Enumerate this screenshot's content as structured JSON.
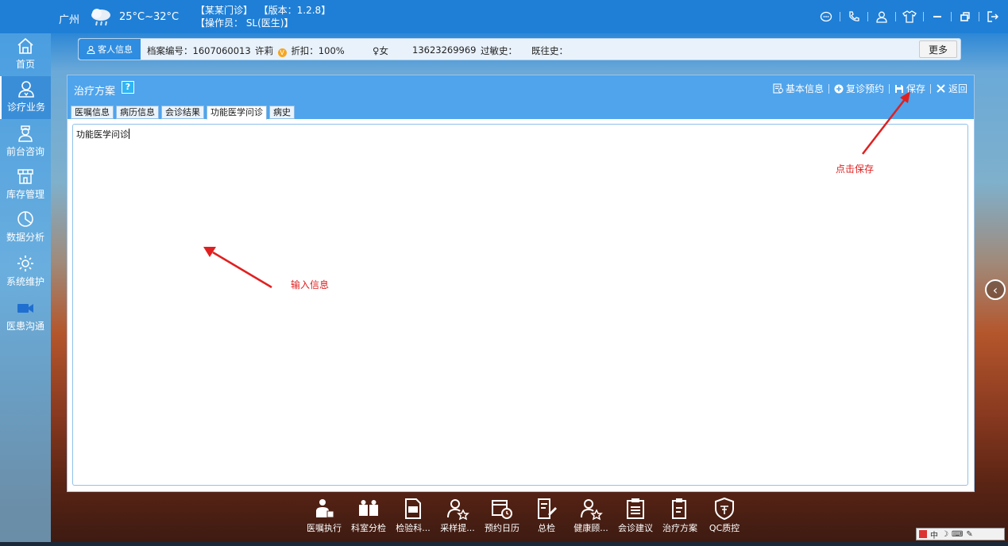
{
  "topbar": {
    "city": "广州",
    "temperature": "25°C~32°C",
    "clinic": "【某某门诊】",
    "version": "【版本：1.2.8】",
    "operator": "【操作员： SL(医生)】",
    "icons": [
      "chat-icon",
      "phone-icon",
      "user-icon",
      "skin-icon",
      "minimize-icon",
      "restore-icon",
      "exit-icon"
    ]
  },
  "sidebar": {
    "items": [
      {
        "label": "首页",
        "icon": "home-icon"
      },
      {
        "label": "诊疗业务",
        "icon": "doctor-icon"
      },
      {
        "label": "前台咨询",
        "icon": "nurse-icon"
      },
      {
        "label": "库存管理",
        "icon": "store-icon"
      },
      {
        "label": "数据分析",
        "icon": "pie-chart-icon"
      },
      {
        "label": "系统维护",
        "icon": "gear-icon"
      },
      {
        "label": "医患沟通",
        "icon": "video-icon"
      }
    ]
  },
  "patient": {
    "tag_label": "客人信息",
    "file_no": "档案编号：1607060013",
    "name": "许莉",
    "vip": "V",
    "discount": "折扣：100%",
    "gender": "女",
    "phone": "13623269969",
    "allergy": "过敏史：",
    "history": "既往史：",
    "more_label": "更多"
  },
  "panel": {
    "title": "治疗方案",
    "help": "?",
    "actions": {
      "basic_info": "基本信息",
      "revisit": "复诊预约",
      "save": "保存",
      "back": "返回"
    },
    "tabs": [
      {
        "label": "医嘱信息",
        "active": false
      },
      {
        "label": "病历信息",
        "active": false
      },
      {
        "label": "会诊结果",
        "active": false
      },
      {
        "label": "功能医学问诊",
        "active": true
      },
      {
        "label": "病史",
        "active": false
      }
    ],
    "editor_text": "功能医学问诊"
  },
  "annotations": {
    "click_save": "点击保存",
    "input_info": "输入信息",
    "color": "#e02020"
  },
  "bottombar": {
    "items": [
      {
        "label": "医嘱执行",
        "icon": "prescription-icon"
      },
      {
        "label": "科室分检",
        "icon": "department-icon"
      },
      {
        "label": "检验科...",
        "icon": "exe-icon"
      },
      {
        "label": "采样提...",
        "icon": "sample-icon"
      },
      {
        "label": "预约日历",
        "icon": "calendar-icon"
      },
      {
        "label": "总检",
        "icon": "edit-icon"
      },
      {
        "label": "健康顾...",
        "icon": "advisor-icon"
      },
      {
        "label": "会诊建议",
        "icon": "clipboard-icon"
      },
      {
        "label": "治疗方案",
        "icon": "document-icon"
      },
      {
        "label": "QC质控",
        "icon": "quality-shield-icon"
      }
    ]
  },
  "ime": {
    "text": "中"
  },
  "colors": {
    "brand": "#1f7fd6",
    "panel_head": "#4fa4ec",
    "accent_red": "#e02020"
  }
}
